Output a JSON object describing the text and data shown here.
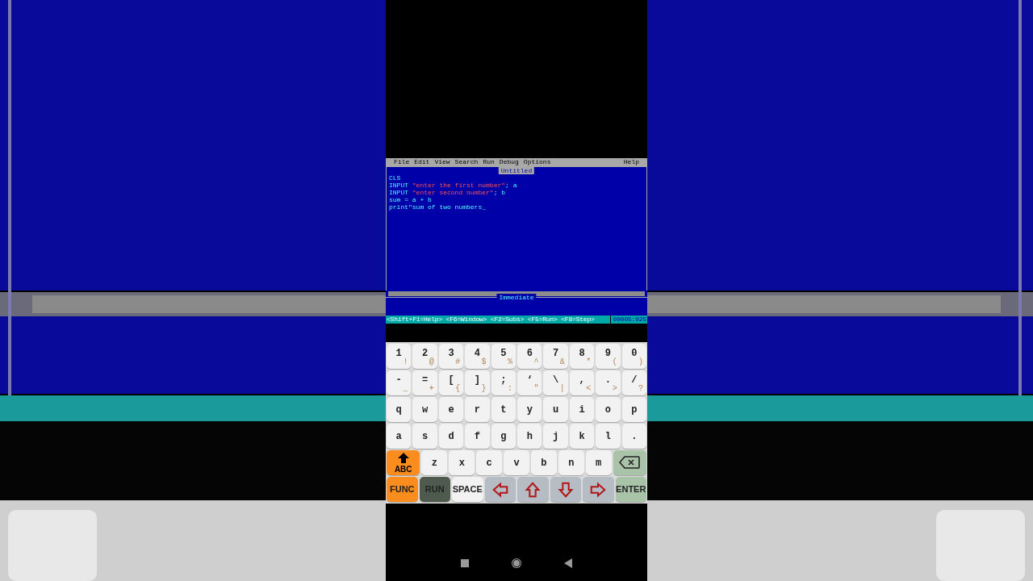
{
  "menu_bar": {
    "items": [
      "File",
      "Edit",
      "View",
      "Search",
      "Run",
      "Debug",
      "Options"
    ],
    "help": "Help"
  },
  "editor": {
    "title": "Untitled",
    "lines": [
      [
        {
          "kind": "keyword",
          "text": "CLS"
        }
      ],
      [
        {
          "kind": "keyword",
          "text": "INPUT "
        },
        {
          "kind": "string",
          "text": "\"enter the first number\""
        },
        {
          "kind": "keyword",
          "text": "; a"
        }
      ],
      [
        {
          "kind": "keyword",
          "text": "INPUT "
        },
        {
          "kind": "string",
          "text": "\"enter second number\""
        },
        {
          "kind": "keyword",
          "text": "; b"
        }
      ],
      [
        {
          "kind": "keyword",
          "text": "sum = a + b"
        }
      ],
      [
        {
          "kind": "keyword",
          "text": "print\"sum of two numbers_"
        }
      ]
    ]
  },
  "immediate": {
    "title": "Immediate"
  },
  "status_bar": {
    "hints": "<Shift+F1=Help> <F6=Window> <F2=Subs> <F5=Run> <F8=Step>",
    "position": "00005:025"
  },
  "keyboard": {
    "number_row": [
      {
        "label": "1",
        "sub": "!"
      },
      {
        "label": "2",
        "sub": "@"
      },
      {
        "label": "3",
        "sub": "#"
      },
      {
        "label": "4",
        "sub": "$"
      },
      {
        "label": "5",
        "sub": "%"
      },
      {
        "label": "6",
        "sub": "^"
      },
      {
        "label": "7",
        "sub": "&"
      },
      {
        "label": "8",
        "sub": "*"
      },
      {
        "label": "9",
        "sub": "("
      },
      {
        "label": "0",
        "sub": ")"
      }
    ],
    "symbol_row": [
      {
        "label": "-",
        "sub": "_"
      },
      {
        "label": "=",
        "sub": "+"
      },
      {
        "label": "[",
        "sub": "{"
      },
      {
        "label": "]",
        "sub": "}"
      },
      {
        "label": ";",
        "sub": ":"
      },
      {
        "label": "‘",
        "sub": "\""
      },
      {
        "label": "\\",
        "sub": "|"
      },
      {
        "label": ",",
        "sub": "<"
      },
      {
        "label": ".",
        "sub": ">"
      },
      {
        "label": "/",
        "sub": "?"
      }
    ],
    "top_letter_row": [
      {
        "label": "q"
      },
      {
        "label": "w"
      },
      {
        "label": "e"
      },
      {
        "label": "r"
      },
      {
        "label": "t"
      },
      {
        "label": "y"
      },
      {
        "label": "u"
      },
      {
        "label": "i"
      },
      {
        "label": "o"
      },
      {
        "label": "p"
      }
    ],
    "middle_letter_row": [
      {
        "label": "a"
      },
      {
        "label": "s"
      },
      {
        "label": "d"
      },
      {
        "label": "f"
      },
      {
        "label": "g"
      },
      {
        "label": "h"
      },
      {
        "label": "j"
      },
      {
        "label": "k"
      },
      {
        "label": "l"
      },
      {
        "label": "."
      }
    ],
    "bottom_letter_row": [
      {
        "kind": "shift",
        "label": "ABC"
      },
      {
        "label": "z"
      },
      {
        "label": "x"
      },
      {
        "label": "c"
      },
      {
        "label": "v"
      },
      {
        "label": "b"
      },
      {
        "label": "n"
      },
      {
        "label": "m"
      },
      {
        "kind": "backspace"
      }
    ],
    "control_row": [
      {
        "kind": "func",
        "label": "FUNC"
      },
      {
        "kind": "run",
        "label": "RUN"
      },
      {
        "kind": "space",
        "label": "SPACE"
      },
      {
        "kind": "left_arrow"
      },
      {
        "kind": "up_arrow"
      },
      {
        "kind": "down_arrow"
      },
      {
        "kind": "right_arrow"
      },
      {
        "kind": "enter",
        "label": "ENTER"
      }
    ]
  }
}
